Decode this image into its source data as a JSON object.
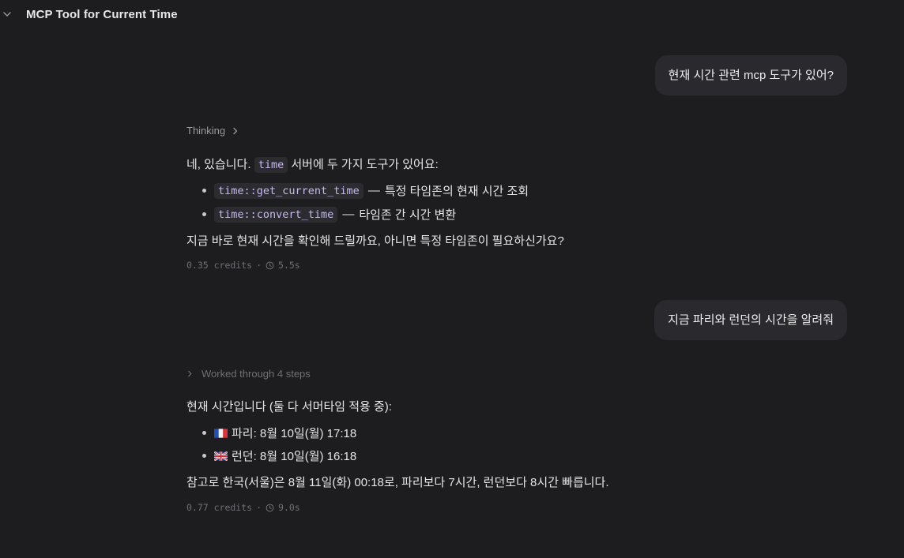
{
  "header": {
    "title": "MCP Tool for Current Time",
    "collapse_icon": "chevron-down-icon"
  },
  "conversation": {
    "turn1": {
      "user_message": "현재 시간 관련 mcp 도구가 있어?",
      "thinking_label": "Thinking",
      "intro_prefix": "네, 있습니다.",
      "intro_code": "time",
      "intro_suffix": "서버에 두 가지 도구가 있어요:",
      "tools": [
        {
          "code": "time::get_current_time",
          "dash": "—",
          "desc": "특정 타임존의 현재 시간 조회"
        },
        {
          "code": "time::convert_time",
          "dash": "—",
          "desc": "타임존 간 시간 변환"
        }
      ],
      "question": "지금 바로 현재 시간을 확인해 드릴까요, 아니면 특정 타임존이 필요하신가요?",
      "credits": "0.35 credits",
      "separator": "·",
      "duration": "5.5s"
    },
    "turn2": {
      "user_message": "지금 파리와 런던의 시간을 알려줘",
      "steps_label": "Worked through 4 steps",
      "intro": "현재 시간입니다 (둘 다 서머타임 적용 중):",
      "times": [
        {
          "flag": "france-flag-icon",
          "text": "파리: 8월 10일(월) 17:18"
        },
        {
          "flag": "uk-flag-icon",
          "text": "런던: 8월 10일(월) 16:18"
        }
      ],
      "note": "참고로 한국(서울)은 8월 11일(화) 00:18로, 파리보다 7시간, 런던보다 8시간 빠릅니다.",
      "credits": "0.77 credits",
      "separator": "·",
      "duration": "9.0s"
    }
  }
}
